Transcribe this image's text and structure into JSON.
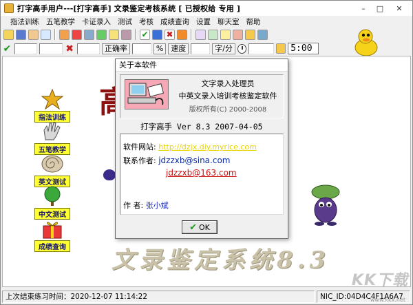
{
  "window": {
    "title": "打字高手用户---[打字高手]     文录鉴定考核系统 [ 已授权给  专用 ]",
    "controls": {
      "minimize": "–",
      "maximize": "□",
      "close": "✕"
    }
  },
  "menu": [
    "指法训练",
    "五笔教学",
    "卡证录入",
    "测试",
    "考核",
    "成绩查询",
    "设置",
    "聊天室",
    "帮助"
  ],
  "toolbar2": {
    "correct_rate_label": "正确率",
    "percent_label": "%",
    "speed_label": "速度",
    "speed_unit": "字/分",
    "timer_value": "5:00"
  },
  "background": {
    "title_prefix": "",
    "title_highlight": "高手",
    "bottom_banner": "文录鉴定系统8.3"
  },
  "sidebar": [
    {
      "label": "指法训练",
      "icon": "star-icon"
    },
    {
      "label": "五笔教学",
      "icon": "hand-icon"
    },
    {
      "label": "英文测试",
      "icon": "shell-icon"
    },
    {
      "label": "中文测试",
      "icon": "tree-icon"
    },
    {
      "label": "成绩查询",
      "icon": "gift-icon"
    }
  ],
  "dialog": {
    "title": "关于本软件",
    "line1": "文字录入处理员",
    "line2": "中英文录入培训考核鉴定软件",
    "line3": "版权所有(C) 2000-2008",
    "version": "打字高手 Ver 8.3    2007-04-05",
    "website_label": "软件网站:",
    "website": "http://dzjx.diy.myrice.com",
    "author_label": "联系作者:",
    "email1": "jdzzxb@sina.com",
    "email2": "jdzzxb@163.com",
    "name_label": "作    者:",
    "name": "张小斌",
    "ok_label": "OK"
  },
  "statusbar": {
    "last_practice": "上次结束练习时间：2020-12-07   11:14:22",
    "nic_id": "NIC_ID:04D4C4F1A6A7"
  },
  "watermark": {
    "main": "KK下载",
    "sub": "www.kkx.net"
  }
}
